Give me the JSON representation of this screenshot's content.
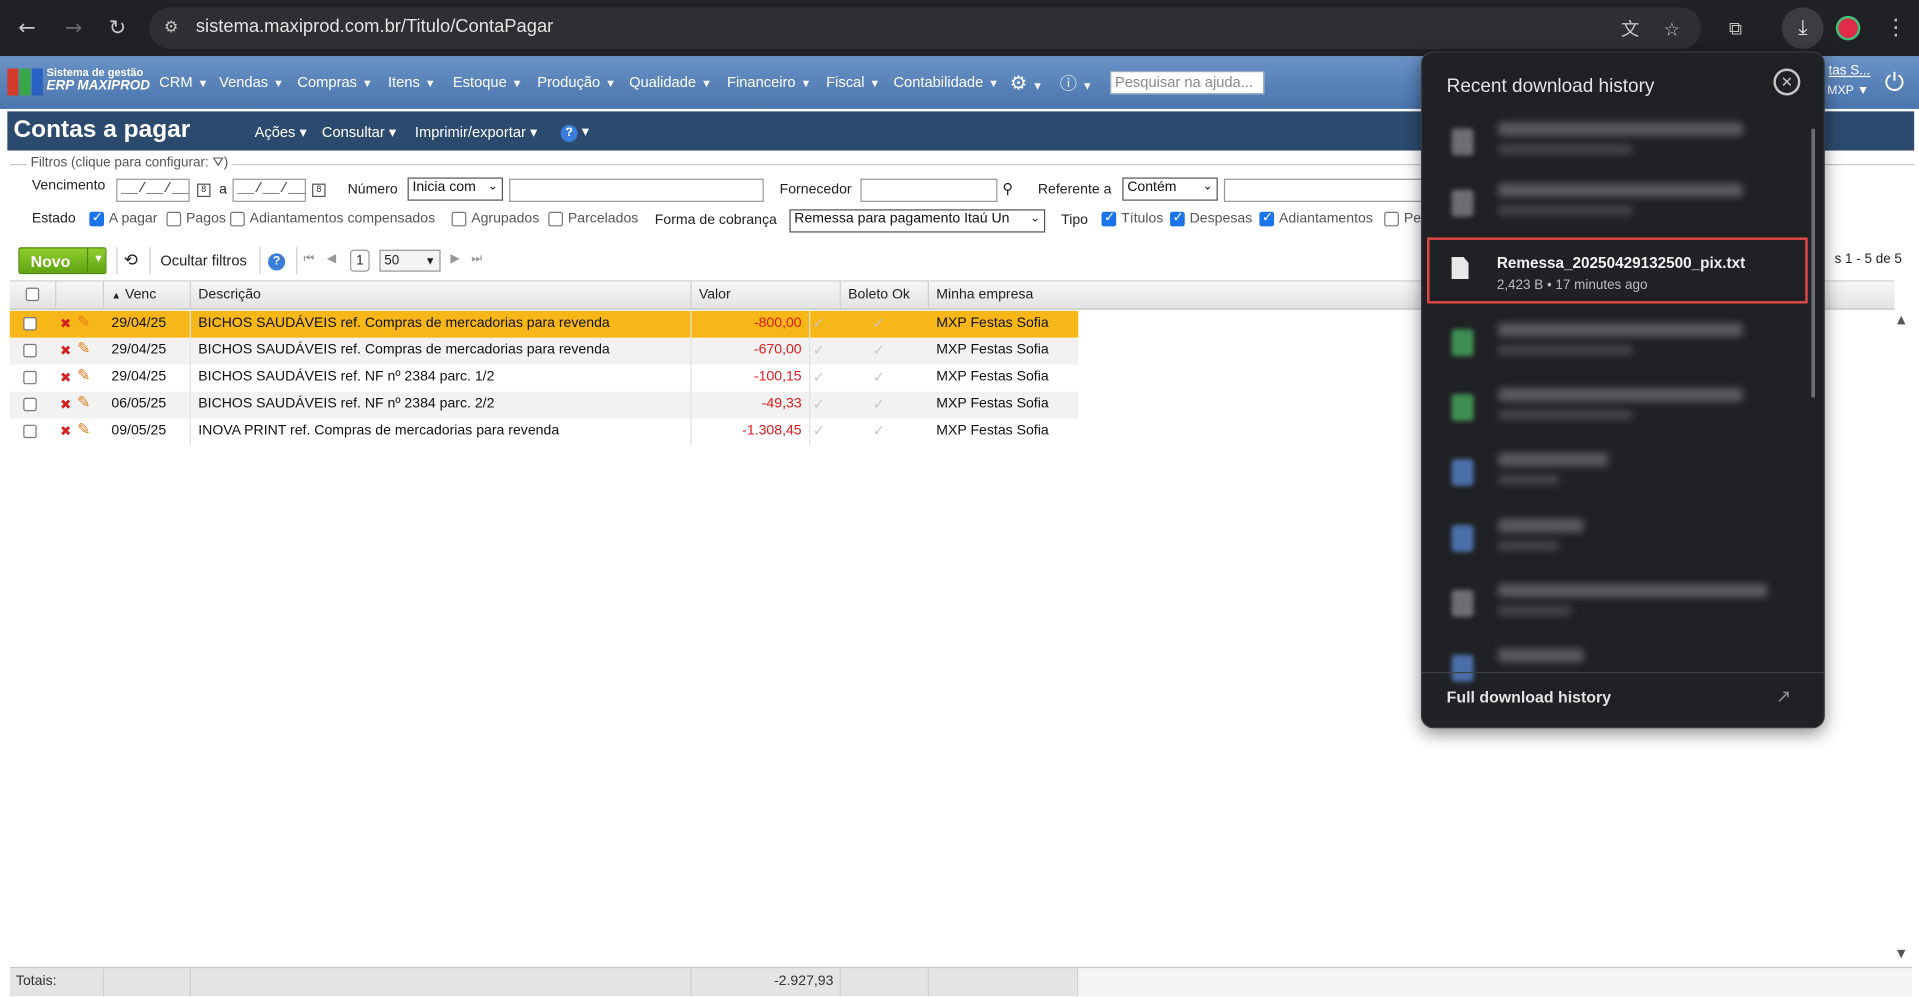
{
  "browser": {
    "url": "sistema.maxiprod.com.br/Titulo/ContaPagar"
  },
  "app": {
    "logo_line1": "Sistema de gestão",
    "logo_line2": "ERP MAXIPROD",
    "menu": [
      "CRM",
      "Vendas",
      "Compras",
      "Itens",
      "Estoque",
      "Produção",
      "Qualidade",
      "Financeiro",
      "Fiscal",
      "Contabilidade"
    ],
    "help_search_placeholder": "Pesquisar na ajuda...",
    "user_name": "tas S...",
    "user_company": "MXP"
  },
  "page": {
    "title": "Contas a pagar",
    "menus": [
      "Ações",
      "Consultar",
      "Imprimir/exportar"
    ]
  },
  "filters": {
    "legend": "Filtros (clique para configurar:",
    "legend_close": ")",
    "vencimento_label": "Vencimento",
    "date_placeholder": "__/__/__",
    "a_label": "a",
    "numero_label": "Número",
    "numero_mode": "Inicia com",
    "fornecedor_label": "Fornecedor",
    "referente_label": "Referente a",
    "referente_mode": "Contém",
    "estado_label": "Estado",
    "estado_options": [
      {
        "label": "A pagar",
        "checked": true
      },
      {
        "label": "Pagos",
        "checked": false
      },
      {
        "label": "Adiantamentos compensados",
        "checked": false
      },
      {
        "label": "Agrupados",
        "checked": false
      },
      {
        "label": "Parcelados",
        "checked": false
      }
    ],
    "forma_label": "Forma de cobrança",
    "forma_value": "Remessa para pagamento Itaú Un",
    "tipo_label": "Tipo",
    "tipo_options": [
      {
        "label": "Títulos",
        "checked": true
      },
      {
        "label": "Despesas",
        "checked": true
      },
      {
        "label": "Adiantamentos",
        "checked": true
      },
      {
        "label": "Pe",
        "checked": false
      }
    ]
  },
  "toolbar": {
    "novo_label": "Novo",
    "hide_filters_label": "Ocultar filtros",
    "page_number": "1",
    "page_size": "50",
    "records_text": "s 1 - 5 de 5"
  },
  "grid": {
    "columns": [
      "Venc",
      "Descrição",
      "Valor",
      "Boleto Ok",
      "Minha empresa"
    ],
    "rows": [
      {
        "venc": "29/04/25",
        "descricao": "BICHOS SAUDÁVEIS ref. Compras de mercadorias para revenda",
        "valor": "-800,00",
        "empresa": "MXP Festas Sofia"
      },
      {
        "venc": "29/04/25",
        "descricao": "BICHOS SAUDÁVEIS ref. Compras de mercadorias para revenda",
        "valor": "-670,00",
        "empresa": "MXP Festas Sofia"
      },
      {
        "venc": "29/04/25",
        "descricao": "BICHOS SAUDÁVEIS ref. NF nº 2384 parc. 1/2",
        "valor": "-100,15",
        "empresa": "MXP Festas Sofia"
      },
      {
        "venc": "06/05/25",
        "descricao": "BICHOS SAUDÁVEIS ref. NF nº 2384 parc. 2/2",
        "valor": "-49,33",
        "empresa": "MXP Festas Sofia"
      },
      {
        "venc": "09/05/25",
        "descricao": "INOVA PRINT ref. Compras de mercadorias para revenda",
        "valor": "-1.308,45",
        "empresa": "MXP Festas Sofia"
      }
    ],
    "totals_label": "Totais:",
    "totals_value": "-2.927,93"
  },
  "downloads": {
    "title": "Recent download history",
    "highlighted": {
      "name": "Remessa_20250429132500_pix.txt",
      "meta": "2,423 B • 17 minutes ago"
    },
    "full_history_label": "Full download history"
  },
  "colors": {
    "selected_row": "#f7b718",
    "negative_value": "#e21a1a",
    "page_header": "#2c4a6e",
    "highlight_border": "#e04848"
  }
}
